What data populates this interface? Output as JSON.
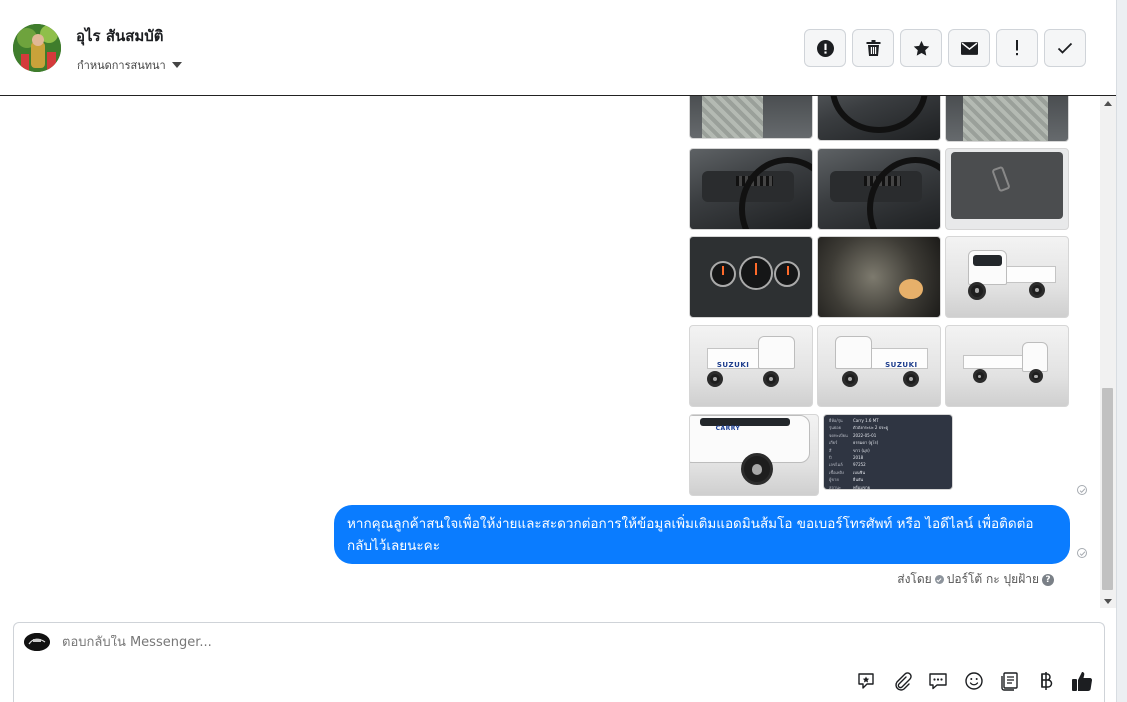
{
  "header": {
    "contact_name": "อุไร สันสมบัติ",
    "conversation_settings": "กำหนดการสนทนา",
    "actions": [
      {
        "name": "mark-spam-button",
        "icon": "alert-circle-icon"
      },
      {
        "name": "delete-button",
        "icon": "trash-icon"
      },
      {
        "name": "star-button",
        "icon": "star-icon"
      },
      {
        "name": "mark-unread-button",
        "icon": "envelope-icon"
      },
      {
        "name": "follow-up-button",
        "icon": "exclamation-icon"
      },
      {
        "name": "mark-done-button",
        "icon": "check-icon"
      }
    ]
  },
  "thread": {
    "car_brand_text": "SUZUKI",
    "info_card": {
      "rows": [
        {
          "k": "ยี่ห้อ/รุ่น",
          "v": "Carry 1.6 MT"
        },
        {
          "k": "รุ่นย่อย",
          "v": "ตัวถังกระบะ 2 ประตู"
        },
        {
          "k": "จดทะเบียน",
          "v": "2022-05-01"
        },
        {
          "k": "เกียร์",
          "v": "ธรรมดา (ยูโร)"
        },
        {
          "k": "สี",
          "v": "ขาว (มุก)"
        },
        {
          "k": "ปี",
          "v": "2018"
        },
        {
          "k": "เลขไมล์",
          "v": "97252"
        },
        {
          "k": "เชื้อเพลิง",
          "v": "เบนซิน"
        },
        {
          "k": "ผู้ขาย",
          "v": "ยืนยัน"
        },
        {
          "k": "สถานะ",
          "v": "พร้อมขาย"
        }
      ]
    },
    "message_text": "หากคุณลูกค้าสนใจเพื่อให้ง่ายและสะดวกต่อการให้ข้อมูลเพิ่มเติมแอดมินส้มโอ ขอเบอร์โทรศัพท์ หรือ ไอดีไลน์ เพื่อติดต่อกลับไว้เลยนะคะ",
    "sent_by_label": "ส่งโดย",
    "sender_name": "ปอร์โต้ กะ ปุยฝ้าย"
  },
  "composer": {
    "placeholder": "ตอบกลับใน Messenger...",
    "tools": [
      "sticker-star-icon",
      "paperclip-icon",
      "saved-replies-icon",
      "emoji-icon",
      "notes-icon",
      "baht-icon",
      "thumbs-up-icon"
    ]
  },
  "colors": {
    "bubble": "#0a7cff",
    "header_border": "#222222"
  }
}
